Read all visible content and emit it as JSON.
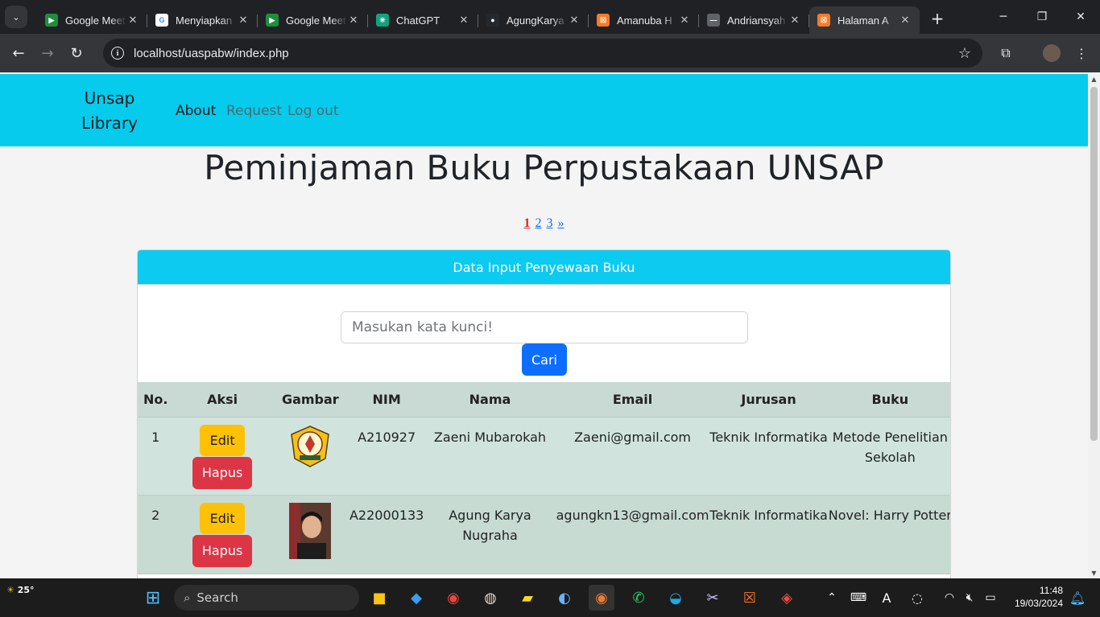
{
  "browser": {
    "tabs": [
      {
        "title": "Google Meet",
        "favicon_color": "#1e8e3e",
        "favicon_glyph": "▶"
      },
      {
        "title": "Menyiapkan",
        "favicon_color": "#ffffff",
        "favicon_glyph": "G"
      },
      {
        "title": "Google Meet",
        "favicon_color": "#1e8e3e",
        "favicon_glyph": "▶"
      },
      {
        "title": "ChatGPT",
        "favicon_color": "#10a37f",
        "favicon_glyph": "✳"
      },
      {
        "title": "AgungKarya",
        "favicon_color": "#24292f",
        "favicon_glyph": "●"
      },
      {
        "title": "Amanuba H",
        "favicon_color": "#fb7a24",
        "favicon_glyph": "☒"
      },
      {
        "title": "Andriansyah",
        "favicon_color": "#5f6368",
        "favicon_glyph": "—"
      },
      {
        "title": "Halaman A",
        "favicon_color": "#fb7a24",
        "favicon_glyph": "☒"
      }
    ],
    "url": "localhost/uaspabw/index.php"
  },
  "navbar": {
    "brand_line1": "Unsap",
    "brand_line2": "Library",
    "links": [
      "About",
      "Request",
      "Log out"
    ]
  },
  "page": {
    "title": "Peminjaman Buku Perpustakaan UNSAP",
    "pagination": [
      "1",
      "2",
      "3",
      "»"
    ],
    "current_page": "1"
  },
  "card": {
    "header": "Data Input Penyewaan Buku",
    "search_placeholder": "Masukan kata kunci!",
    "search_button": "Cari"
  },
  "table": {
    "headers": [
      "No.",
      "Aksi",
      "Gambar",
      "NIM",
      "Nama",
      "Email",
      "Jurusan",
      "Buku"
    ],
    "edit_label": "Edit",
    "delete_label": "Hapus",
    "rows": [
      {
        "no": "1",
        "image": "university-logo",
        "nim": "A210927",
        "nama": "Zaeni Mubarokah",
        "email": "Zaeni@gmail.com",
        "jurusan": "Teknik Informatika",
        "buku": "Metode Penelitian Sekolah"
      },
      {
        "no": "2",
        "image": "profile-photo",
        "nim": "A22000133",
        "nama": "Agung Karya Nugraha",
        "email": "agungkn13@gmail.com",
        "jurusan": "Teknik Informatika",
        "buku": "Novel: Harry Potter"
      }
    ]
  },
  "taskbar": {
    "weather": "25°",
    "search_label": "Search",
    "time": "11:48",
    "date": "19/03/2024"
  },
  "colors": {
    "navbar": "#06cbed",
    "card_header": "#0dcaf0",
    "search_button": "#0d6efd",
    "edit_button": "#ffc107",
    "delete_button": "#dc3545",
    "pagination_current": "#dc2626"
  }
}
